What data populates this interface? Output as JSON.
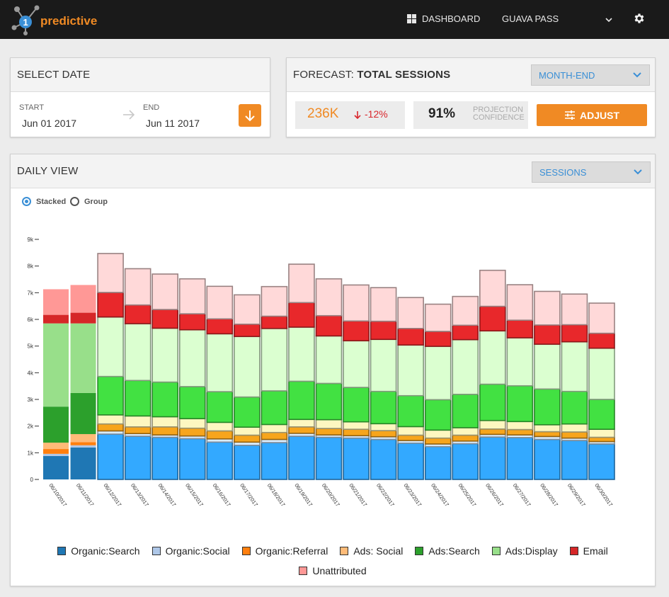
{
  "header": {
    "brand": "predictive",
    "brand_badge": "1",
    "nav_dashboard": "DASHBOARD",
    "account": "GUAVA PASS",
    "icons": [
      "dashboard-grid-icon",
      "chevron-down-icon",
      "gear-icon"
    ]
  },
  "select_date": {
    "title": "SELECT DATE",
    "start_label": "START",
    "start_value": "Jun 01 2017",
    "end_label": "END",
    "end_value": "Jun 11 2017"
  },
  "forecast": {
    "title_prefix": "FORECAST:",
    "title_bold": "TOTAL SESSIONS",
    "period": "MONTH-END",
    "sessions": "236K",
    "delta": "-12%",
    "confidence": "91%",
    "confidence_label_1": "PROJECTION",
    "confidence_label_2": "CONFIDENCE",
    "adjust_label": "ADJUST"
  },
  "daily_view": {
    "title": "DAILY VIEW",
    "metric": "SESSIONS",
    "mode_stacked": "Stacked",
    "mode_group": "Group",
    "selected_mode": "Stacked"
  },
  "colors": {
    "brand_orange": "#f08a24",
    "accent_blue": "#3a8fd6",
    "negative_red": "#d9262c"
  },
  "chart_data": {
    "type": "bar",
    "stacked": true,
    "ylim": [
      0,
      9000
    ],
    "yticks": [
      "0",
      "1k",
      "2k",
      "3k",
      "4k",
      "5k",
      "6k",
      "7k",
      "8k",
      "9k"
    ],
    "ytick_values": [
      0,
      1000,
      2000,
      3000,
      4000,
      5000,
      6000,
      7000,
      8000,
      9000
    ],
    "categories": [
      "06/10/2017",
      "06/11/2017",
      "06/12/2017",
      "06/13/2017",
      "06/14/2017",
      "06/15/2017",
      "06/16/2017",
      "06/17/2017",
      "06/18/2017",
      "06/19/2017",
      "06/20/2017",
      "06/21/2017",
      "06/22/2017",
      "06/23/2017",
      "06/24/2017",
      "06/25/2017",
      "06/26/2017",
      "06/27/2017",
      "06/28/2017",
      "06/29/2017",
      "06/30/2017"
    ],
    "actual_count": 2,
    "series": [
      {
        "name": "Organic:Search",
        "color_actual": "#1f77b4",
        "color_forecast": "#33a9ff",
        "values": [
          880,
          1200,
          1700,
          1620,
          1580,
          1530,
          1400,
          1280,
          1380,
          1620,
          1580,
          1550,
          1500,
          1360,
          1230,
          1340,
          1590,
          1570,
          1500,
          1460,
          1330
        ]
      },
      {
        "name": "Organic:Social",
        "color_actual": "#aec7e8",
        "color_forecast": "#d9ecff",
        "values": [
          80,
          80,
          120,
          100,
          90,
          100,
          120,
          120,
          120,
          110,
          90,
          90,
          100,
          100,
          100,
          100,
          100,
          100,
          110,
          90,
          90
        ]
      },
      {
        "name": "Organic:Referral",
        "color_actual": "#ff7f0e",
        "color_forecast": "#f7a51c",
        "values": [
          180,
          120,
          260,
          250,
          300,
          290,
          300,
          260,
          260,
          240,
          240,
          240,
          230,
          200,
          220,
          220,
          200,
          200,
          180,
          230,
          160
        ]
      },
      {
        "name": "Ads: Social",
        "color_actual": "#ffbb78",
        "color_forecast": "#fdf7c0",
        "values": [
          240,
          300,
          340,
          410,
          380,
          360,
          320,
          300,
          300,
          280,
          330,
          280,
          260,
          320,
          300,
          280,
          320,
          300,
          260,
          300,
          300
        ]
      },
      {
        "name": "Ads:Search",
        "color_actual": "#2ca02c",
        "color_forecast": "#42e142",
        "values": [
          1350,
          1540,
          1440,
          1330,
          1300,
          1200,
          1150,
          1130,
          1260,
          1430,
          1360,
          1290,
          1210,
          1160,
          1140,
          1250,
          1360,
          1340,
          1340,
          1220,
          1120
        ]
      },
      {
        "name": "Ads:Display",
        "color_actual": "#98df8a",
        "color_forecast": "#dbffd0",
        "values": [
          3120,
          2610,
          2230,
          2130,
          2020,
          2130,
          2170,
          2270,
          2340,
          2030,
          1780,
          1750,
          1950,
          1900,
          2000,
          2050,
          2000,
          1800,
          1680,
          1860,
          1920
        ]
      },
      {
        "name": "Email",
        "color_actual": "#d62728",
        "color_forecast": "#e8282b",
        "values": [
          320,
          400,
          920,
          700,
          700,
          600,
          560,
          460,
          460,
          920,
          760,
          740,
          680,
          620,
          560,
          540,
          920,
          660,
          720,
          640,
          560
        ]
      },
      {
        "name": "Unattributed",
        "color_actual": "#ff9896",
        "color_forecast": "#ffd9d9",
        "values": [
          960,
          1040,
          1460,
          1360,
          1330,
          1310,
          1220,
          1100,
          1110,
          1440,
          1380,
          1350,
          1260,
          1160,
          1020,
          1080,
          1350,
          1330,
          1260,
          1150,
          1130
        ]
      }
    ]
  }
}
